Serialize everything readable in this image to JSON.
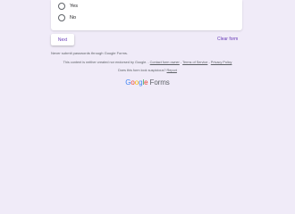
{
  "question": {
    "options": [
      {
        "label": "Yes"
      },
      {
        "label": "No"
      }
    ]
  },
  "actions": {
    "next_label": "Next",
    "clear_label": "Clear form"
  },
  "footer": {
    "password_warning": "Never submit passwords through Google Forms.",
    "disclaimer_text": "This content is neither created nor endorsed by Google. -",
    "contact_owner": "Contact form owner",
    "sep1": " - ",
    "terms": "Terms of Service",
    "sep2": " - ",
    "privacy": "Privacy Policy",
    "suspicious_text": "Does this form look suspicious?",
    "report": "Report",
    "logo_letters": [
      "G",
      "o",
      "o",
      "g",
      "l",
      "e"
    ],
    "logo_product": "Forms"
  }
}
